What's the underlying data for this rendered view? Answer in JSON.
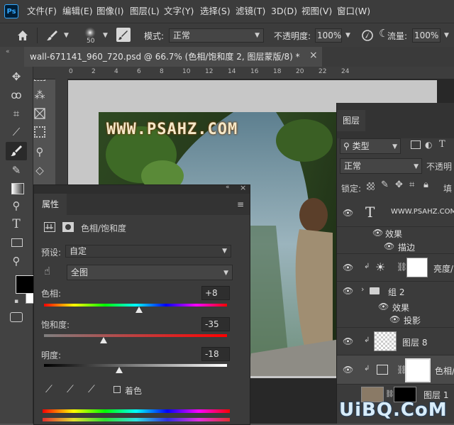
{
  "app": {
    "logo": "Ps"
  },
  "menu": [
    "文件(F)",
    "编辑(E)",
    "图像(I)",
    "图层(L)",
    "文字(Y)",
    "选择(S)",
    "滤镜(T)",
    "3D(D)",
    "视图(V)",
    "窗口(W)"
  ],
  "options": {
    "brush_size": "50",
    "mode_label": "模式:",
    "mode_value": "正常",
    "opacity_label": "不透明度:",
    "opacity_value": "100%",
    "flow_label": "流量:",
    "flow_value": "100%"
  },
  "document": {
    "tab_title": "wall-671141_960_720.psd @ 66.7% (色相/饱和度 2, 图层蒙版/8) *",
    "close": "×",
    "ruler_labels": [
      "0",
      "2",
      "4",
      "6",
      "8",
      "10",
      "12",
      "14",
      "16",
      "18",
      "20",
      "22",
      "24"
    ],
    "watermark": "WWW.PSAHZ.COM"
  },
  "properties": {
    "tab": "属性",
    "adjustment_title": "色相/饱和度",
    "preset_label": "预设:",
    "preset_value": "自定",
    "channel_value": "全图",
    "hue_label": "色相:",
    "hue_value": "+8",
    "hue_level": 0.52,
    "saturation_label": "饱和度:",
    "saturation_value": "-35",
    "saturation_level": 0.325,
    "lightness_label": "明度:",
    "lightness_value": "-18",
    "lightness_level": 0.41,
    "colorize_label": "着色"
  },
  "layers": {
    "tab": "图层",
    "filter_label": "类型",
    "blend_mode": "正常",
    "opacity_label": "不透明",
    "lock_label": "锁定:",
    "fill_label": "填",
    "rows": [
      {
        "name": "WWW.PSAHZ.COM",
        "kind": "text"
      },
      {
        "name": "效果",
        "kind": "effects"
      },
      {
        "name": "描边",
        "kind": "effect"
      },
      {
        "name": "亮度/",
        "kind": "adjustment"
      },
      {
        "name": "组 2",
        "kind": "group"
      },
      {
        "name": "效果",
        "kind": "effects"
      },
      {
        "name": "投影",
        "kind": "effect"
      },
      {
        "name": "图层 8",
        "kind": "pixel"
      },
      {
        "name": "色相/",
        "kind": "adjustment"
      },
      {
        "name": "图层 1",
        "kind": "pixel"
      }
    ]
  },
  "site_watermark": "UiBQ.CoM",
  "colors": {
    "foreground": "#000000",
    "background": "#ffffff",
    "accent": "#31a8ff"
  }
}
